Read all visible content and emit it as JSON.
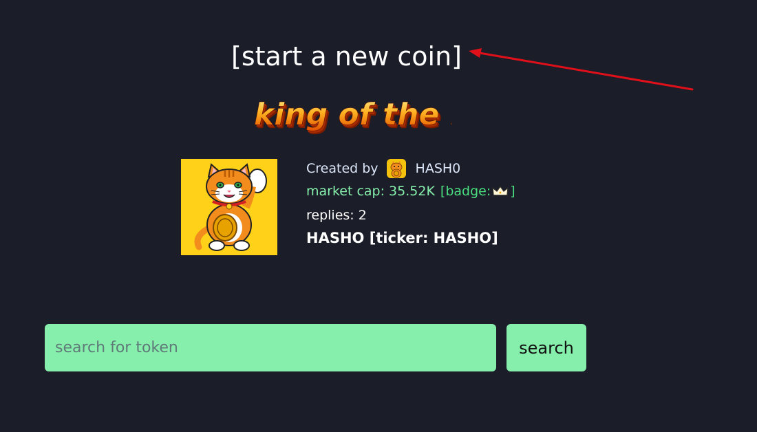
{
  "header": {
    "start_new_coin_label": "[start a new coin]"
  },
  "king_of_the_hill": {
    "logo_text": "king of the hill"
  },
  "token": {
    "created_by_label": "Created by",
    "creator_name": "HASH0",
    "market_cap_text": "market cap: 35.52K",
    "badge_prefix": "[badge:",
    "badge_suffix": "]",
    "badge_icon": "crown-icon",
    "replies_text": "replies: 2",
    "name_ticker": "HASHO [ticker: HASHO]",
    "image_icon": "lucky-cat-icon",
    "creator_avatar_icon": "lucky-cat-icon"
  },
  "search": {
    "placeholder": "search for token",
    "value": "",
    "button_label": "search"
  },
  "colors": {
    "background": "#1b1d28",
    "accent_green": "#86efac",
    "badge_green": "#4ade80",
    "annotation_arrow": "#e0101a",
    "image_background": "#ffd219"
  }
}
